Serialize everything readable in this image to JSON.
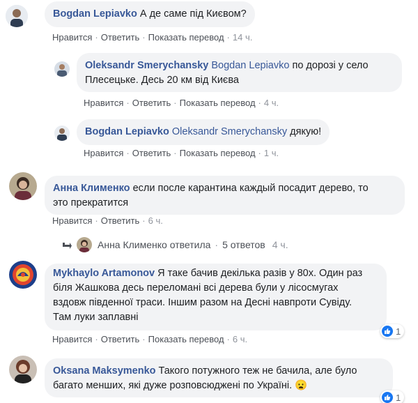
{
  "actions": {
    "like": "Нравится",
    "reply": "Ответить",
    "translate": "Показать перевод",
    "separator": "·"
  },
  "comments": [
    {
      "author": "Bogdan Lepiavko",
      "text": "А де саме під Києвом?",
      "time": "14 ч."
    },
    {
      "author": "Oleksandr Smerychansky",
      "mention": "Bogdan Lepiavko",
      "text_line1": "по дорозі у село",
      "text_line2": "Плесецьке. Десь 20 км від Києва",
      "time": "4 ч."
    },
    {
      "author": "Bogdan Lepiavko",
      "mention": "Oleksandr Smerychansky",
      "text": "дякую!",
      "time": "1 ч."
    },
    {
      "author": "Анна Клименко",
      "text_line1": "если после карантина каждый посадит дерево, то",
      "text_line2": "это прекратится",
      "time": "6 ч."
    },
    {
      "author": "Mykhaylo Artamonov",
      "text_line1": "Я таке бачив декілька разів у 80х. Один раз",
      "text_line2": "біля Жашкова десь переломані всі дерева були у лісосмугах",
      "text_line3": "вздовж південної траси. Іншим разом на Десні навпроти Сувіду.",
      "text_line4": "Там луки заплавні",
      "time": "6 ч.",
      "reactions": "1"
    },
    {
      "author": "Oksana Maksymenko",
      "text_line1": "Такого потужного теж не бачила, але було",
      "text_line2": "багато менших, які дуже розповсюджені по Україні.",
      "emoji": "😦",
      "reactions": "1"
    }
  ],
  "replies": {
    "author": "Анна Клименко",
    "verb": "ответила",
    "count": "5 ответов",
    "separator": "·",
    "time": "4 ч."
  },
  "colors": {
    "author": "#385898",
    "bubble": "#f2f3f5",
    "like_blue": "#1877f2"
  },
  "icons": {
    "reply_arrow": "reply-arrow-icon",
    "like": "thumbs-up-icon"
  }
}
